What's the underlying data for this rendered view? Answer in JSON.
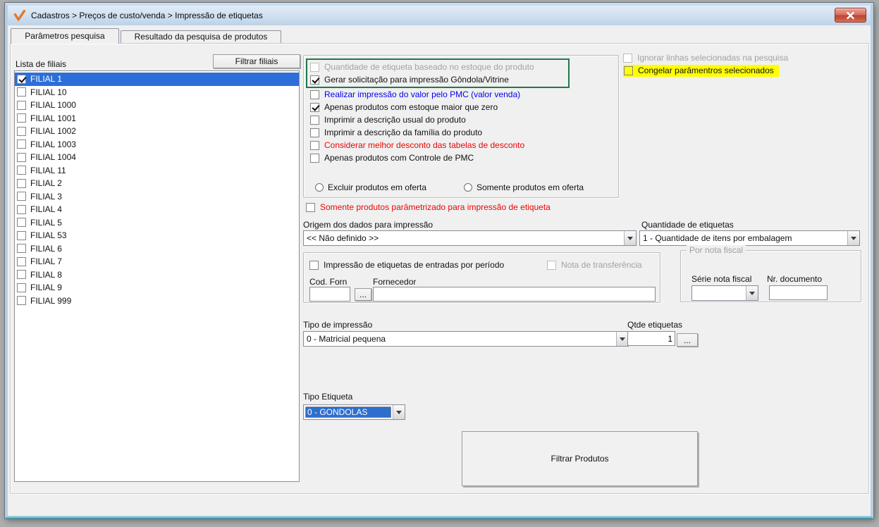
{
  "window": {
    "title": "Cadastros > Preços de custo/venda > Impressão de etiquetas"
  },
  "tabs": {
    "parametros": "Parâmetros pesquisa",
    "resultado": "Resultado da pesquisa de produtos"
  },
  "filiais": {
    "label": "Lista de filiais",
    "filter_button": "Filtrar filiais",
    "items": [
      {
        "name": "FILIAL 1",
        "checked": true,
        "selected": true
      },
      {
        "name": "FILIAL 10",
        "checked": false,
        "selected": false
      },
      {
        "name": "FILIAL 1000",
        "checked": false,
        "selected": false
      },
      {
        "name": "FILIAL 1001",
        "checked": false,
        "selected": false
      },
      {
        "name": "FILIAL 1002",
        "checked": false,
        "selected": false
      },
      {
        "name": "FILIAL 1003",
        "checked": false,
        "selected": false
      },
      {
        "name": "FILIAL 1004",
        "checked": false,
        "selected": false
      },
      {
        "name": "FILIAL 11",
        "checked": false,
        "selected": false
      },
      {
        "name": "FILIAL 2",
        "checked": false,
        "selected": false
      },
      {
        "name": "FILIAL 3",
        "checked": false,
        "selected": false
      },
      {
        "name": "FILIAL 4",
        "checked": false,
        "selected": false
      },
      {
        "name": "FILIAL 5",
        "checked": false,
        "selected": false
      },
      {
        "name": "FILIAL 53",
        "checked": false,
        "selected": false
      },
      {
        "name": "FILIAL 6",
        "checked": false,
        "selected": false
      },
      {
        "name": "FILIAL 7",
        "checked": false,
        "selected": false
      },
      {
        "name": "FILIAL 8",
        "checked": false,
        "selected": false
      },
      {
        "name": "FILIAL 9",
        "checked": false,
        "selected": false
      },
      {
        "name": "FILIAL 999",
        "checked": false,
        "selected": false
      }
    ]
  },
  "options": {
    "highlight_frame_color": "#1e7a4b",
    "checkboxes": [
      {
        "label": "Quantidade de etiqueta baseado no estoque do produto",
        "checked": false,
        "style": "disabled",
        "framed": true
      },
      {
        "label": "Gerar solicitação para impressão Gôndola/Vitrine",
        "checked": true,
        "style": "",
        "framed": true
      },
      {
        "label": "Realizar impressão do valor pelo PMC (valor venda)",
        "checked": false,
        "style": "blue",
        "framed": false
      },
      {
        "label": "Apenas produtos com estoque maior que zero",
        "checked": true,
        "style": "",
        "framed": false
      },
      {
        "label": "Imprimir a descrição usual do produto",
        "checked": false,
        "style": "",
        "framed": false
      },
      {
        "label": "Imprimir a descrição da família do produto",
        "checked": false,
        "style": "",
        "framed": false
      },
      {
        "label": "Considerar melhor desconto das tabelas de desconto",
        "checked": false,
        "style": "red",
        "framed": false
      },
      {
        "label": "Apenas produtos com Controle de PMC",
        "checked": false,
        "style": "",
        "framed": false
      }
    ],
    "radio_excluir": "Excluir produtos em oferta",
    "radio_somente": "Somente produtos em oferta"
  },
  "right_options": {
    "ignorar": "Ignorar linhas selecionadas na pesquisa",
    "congelar": "Congelar parâmentros selecionados",
    "congelar_highlight": "#ffff00"
  },
  "somente_parametrizado": "Somente produtos parâmetrizado para impressão de etiqueta",
  "origem": {
    "label": "Origem dos dados para impressão",
    "value": "<< Não definido >>"
  },
  "quantidade_etiquetas": {
    "label": "Quantidade de  etiquetas",
    "value": "1 - Quantidade de itens por embalagem"
  },
  "entradas": {
    "checkbox": "Impressão de etiquetas de entradas por período",
    "nota_transferencia": "Nota de transferência",
    "cod_forn_label": "Cod. Forn",
    "fornecedor_label": "Fornecedor",
    "cod_forn_value": "",
    "fornecedor_value": ""
  },
  "nota_fiscal": {
    "title": "Por nota fiscal",
    "serie_label": "Série nota fiscal",
    "nr_documento_label": "Nr. documento",
    "serie_value": "",
    "nr_documento_value": ""
  },
  "tipo_impressao": {
    "label": "Tipo de impressão",
    "value": "0 - Matricial pequena"
  },
  "qtde_etiquetas": {
    "label": "Qtde etiquetas",
    "value": "1"
  },
  "tipo_etiqueta": {
    "label": "Tipo Etiqueta",
    "value": "0 - GONDOLAS"
  },
  "filtrar_produtos": "Filtrar Produtos",
  "ui": {
    "browse_label": "..."
  }
}
